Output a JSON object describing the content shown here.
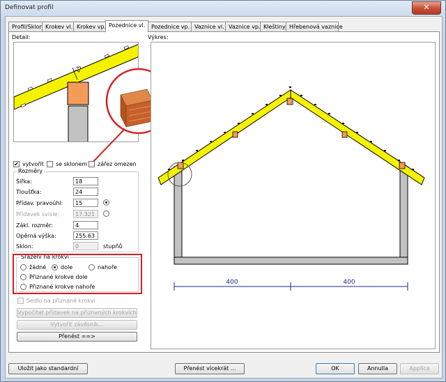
{
  "window": {
    "title": "Definovat profil",
    "close_glyph": "✕"
  },
  "tabs": [
    {
      "label": "Profil/Sklon"
    },
    {
      "label": "Krokev vl."
    },
    {
      "label": "Krokev vp."
    },
    {
      "label": "Pozednice vl."
    },
    {
      "label": "Pozednice vp."
    },
    {
      "label": "Vaznice vl."
    },
    {
      "label": "Vaznice vp."
    },
    {
      "label": "Kleštiny"
    },
    {
      "label": "Hřebenová vaznice"
    }
  ],
  "active_tab": "Pozednice vl.",
  "detail": {
    "label": "Detail:",
    "dimension": "15"
  },
  "drawing": {
    "label": "Výkres:",
    "dimensions": [
      "400",
      "400"
    ]
  },
  "options": {
    "vytvorit": {
      "label": "vytvořit",
      "checked": true
    },
    "se_sklonem": {
      "label": "se sklonem",
      "checked": false
    },
    "zarez": {
      "label": "zářez omezen",
      "checked": false
    }
  },
  "rozmery": {
    "title": "Rozměry",
    "sirka": {
      "label": "Šířka:",
      "value": "18"
    },
    "tloustka": {
      "label": "Tloušťka:",
      "value": "24"
    },
    "pridav_pravouhl": {
      "label": "Přídav. pravoúhl:",
      "value": "15"
    },
    "pridavek_svisle": {
      "label": "Přídavek svisle:",
      "value": "17.321"
    },
    "zakl_rozmer": {
      "label": "Zákl. rozměr:",
      "value": "4"
    },
    "operna_vyska": {
      "label": "Opěrná výška:",
      "value": "255.63"
    },
    "sklon": {
      "label": "Sklon:",
      "value": "0",
      "unit": "stupňů"
    }
  },
  "srazeni": {
    "title": "Sražení na krokvi",
    "zadne": "žádné",
    "dole": "dole",
    "nahore": "nahoře",
    "priznane_dole": "Přiznané krokve dole",
    "priznane_nahore": "Přiznané krokve nahoře",
    "selected": "dole"
  },
  "sedlo": {
    "label": "Sedlo na přiznané krokvi"
  },
  "buttons": {
    "vypocitat": "Vypočítat přídavek na přiznaných krokvích",
    "vytvorit_zavesnik": "Vytvořit závěsník...",
    "prenest": "Přenést ==>",
    "ulozit": "Uložit jako standardní",
    "prenest_vicekrat": "Přenést vícekrát ...",
    "ok": "OK",
    "annulla": "Annulla",
    "applica": "Applica"
  },
  "colors": {
    "highlight": "#d42020",
    "rafter": "#f5f200",
    "wallplate": "#f39c5a",
    "wall": "#c2c2c2"
  }
}
